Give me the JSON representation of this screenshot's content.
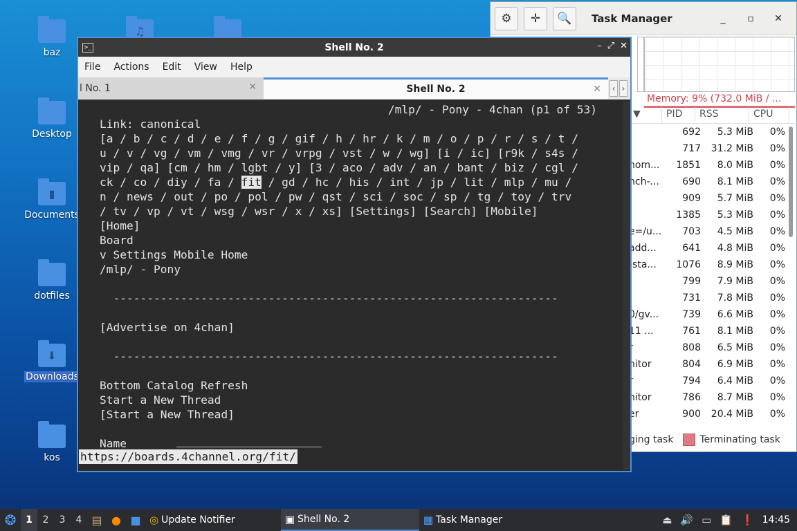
{
  "desktop": {
    "icons": [
      {
        "label": "baz",
        "glyph": ""
      },
      {
        "label": "Desktop",
        "glyph": ""
      },
      {
        "label": "Documents",
        "glyph": "▮"
      },
      {
        "label": "dotfiles",
        "glyph": ""
      },
      {
        "label": "Downloads",
        "glyph": "⬇"
      },
      {
        "label": "kos",
        "glyph": ""
      }
    ]
  },
  "taskmanager": {
    "title": "Task Manager",
    "memory": "Memory: 9% (732.0 MiB / ...",
    "columns": [
      "PID",
      "RSS",
      "CPU"
    ],
    "rows": [
      {
        "name": "",
        "pid": "692",
        "rss": "5.3 MiB",
        "cpu": "0%"
      },
      {
        "name": "",
        "pid": "717",
        "rss": "31.2 MiB",
        "cpu": "0%"
      },
      {
        "name": "hom...",
        "pid": "1851",
        "rss": "8.0 MiB",
        "cpu": "0%"
      },
      {
        "name": "nch-...",
        "pid": "690",
        "rss": "8.1 MiB",
        "cpu": "0%"
      },
      {
        "name": "",
        "pid": "909",
        "rss": "5.7 MiB",
        "cpu": "0%"
      },
      {
        "name": "",
        "pid": "1385",
        "rss": "5.3 MiB",
        "cpu": "0%"
      },
      {
        "name": "e=/u...",
        "pid": "703",
        "rss": "4.5 MiB",
        "cpu": "0%"
      },
      {
        "name": "add...",
        "pid": "641",
        "rss": "4.8 MiB",
        "cpu": "0%"
      },
      {
        "name": "-sta...",
        "pid": "1076",
        "rss": "8.9 MiB",
        "cpu": "0%"
      },
      {
        "name": "",
        "pid": "799",
        "rss": "7.9 MiB",
        "cpu": "0%"
      },
      {
        "name": "",
        "pid": "731",
        "rss": "7.8 MiB",
        "cpu": "0%"
      },
      {
        "name": "0/gv...",
        "pid": "739",
        "rss": "6.6 MiB",
        "cpu": "0%"
      },
      {
        "name": "11 ...",
        "pid": "761",
        "rss": "8.1 MiB",
        "cpu": "0%"
      },
      {
        "name": "r",
        "pid": "808",
        "rss": "6.5 MiB",
        "cpu": "0%"
      },
      {
        "name": "nitor",
        "pid": "804",
        "rss": "6.9 MiB",
        "cpu": "0%"
      },
      {
        "name": "r",
        "pid": "794",
        "rss": "6.4 MiB",
        "cpu": "0%"
      },
      {
        "name": "nitor",
        "pid": "786",
        "rss": "8.7 MiB",
        "cpu": "0%"
      },
      {
        "name": "er",
        "pid": "900",
        "rss": "20.4 MiB",
        "cpu": "0%"
      }
    ],
    "legend_left": "ging task",
    "legend_terminating": "Terminating task"
  },
  "shell": {
    "title": "Shell No. 2",
    "menu": [
      "File",
      "Actions",
      "Edit",
      "View",
      "Help"
    ],
    "tab1": "l No. 1",
    "tab2": "Shell No. 2",
    "header": "/mlp/ - Pony - 4chan (p1 of 53)",
    "lines": {
      "l1": "Link: canonical",
      "l2": "[a / b / c / d / e / f / g / gif / h / hr / k / m / o / p / r / s / t /",
      "l3": "u / v / vg / vm / vmg / vr / vrpg / vst / w / wg] [i / ic] [r9k / s4s /",
      "l4": "vip / qa] [cm / hm / lgbt / y] [3 / aco / adv / an / bant / biz / cgl /",
      "l5a": "ck / co / diy / fa / ",
      "l5b": "fit",
      "l5c": " / gd / hc / his / int / jp / lit / mlp / mu /",
      "l6": "n / news / out / po / pol / pw / qst / sci / soc / sp / tg / toy / trv",
      "l7": "/ tv / vp / vt / wsg / wsr / x / xs] [Settings] [Search] [Mobile]",
      "l8": "[Home]",
      "l9": "Board",
      "l10": "v Settings Mobile Home",
      "l11": "/mlp/ - Pony",
      "l12": "",
      "l13": "  ------------------------------------------------------------------",
      "l14": "",
      "l15": "[Advertise on 4chan]",
      "l16": "",
      "l17": "  ------------------------------------------------------------------",
      "l18": "",
      "l19": "Bottom Catalog Refresh",
      "l20": "Start a New Thread",
      "l21": "[Start a New Thread]",
      "l22": "",
      "l23": "Name"
    },
    "status": "https://boards.4channel.org/fit/"
  },
  "taskbar": {
    "workspaces": [
      "1",
      "2",
      "3",
      "4"
    ],
    "tasks": [
      "Update Notifier",
      "Shell No. 2",
      "Task Manager"
    ],
    "clock": "14:45"
  }
}
